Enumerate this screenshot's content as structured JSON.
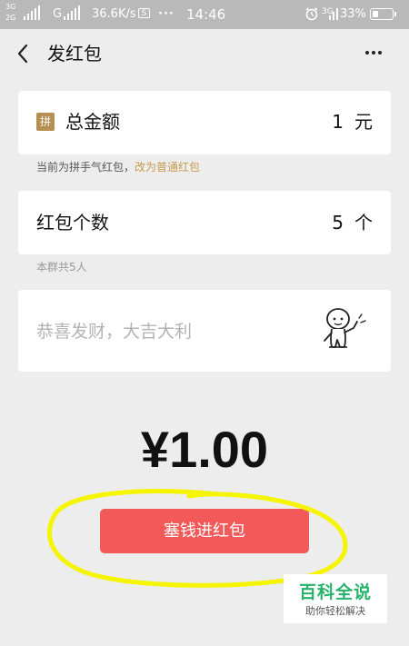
{
  "status_bar": {
    "network_top": "3G",
    "network_bottom": "2G",
    "network_g": "G",
    "speed": "36.6K/s",
    "box_glyph": "S",
    "dots": "···",
    "time": "14:46",
    "network_right": "3G",
    "battery": "33%",
    "battery_level": 0.33
  },
  "nav": {
    "title": "发红包",
    "back_icon": "back-chevron-icon",
    "more_icon": "more-dots-icon"
  },
  "total_amount": {
    "badge": "拼",
    "label": "总金额",
    "value": "1",
    "unit": "元"
  },
  "hint_mode": {
    "text": "当前为拼手气红包，",
    "link": "改为普通红包"
  },
  "packet_count": {
    "label": "红包个数",
    "value": "5",
    "unit": "个"
  },
  "group_hint": "本群共5人",
  "greeting": {
    "placeholder": "恭喜发财，大吉大利",
    "emoji_icon": "waving-person-icon"
  },
  "amount_display": "¥1.00",
  "submit_label": "塞钱进红包",
  "watermark": {
    "title": "百科全说",
    "subtitle": "助你轻松解决"
  },
  "colors": {
    "background": "#ededed",
    "button": "#f25a5a",
    "link": "#c79b4b",
    "badge": "#b58e52",
    "annotation": "#f5f500",
    "watermark_green": "#27b26b"
  }
}
